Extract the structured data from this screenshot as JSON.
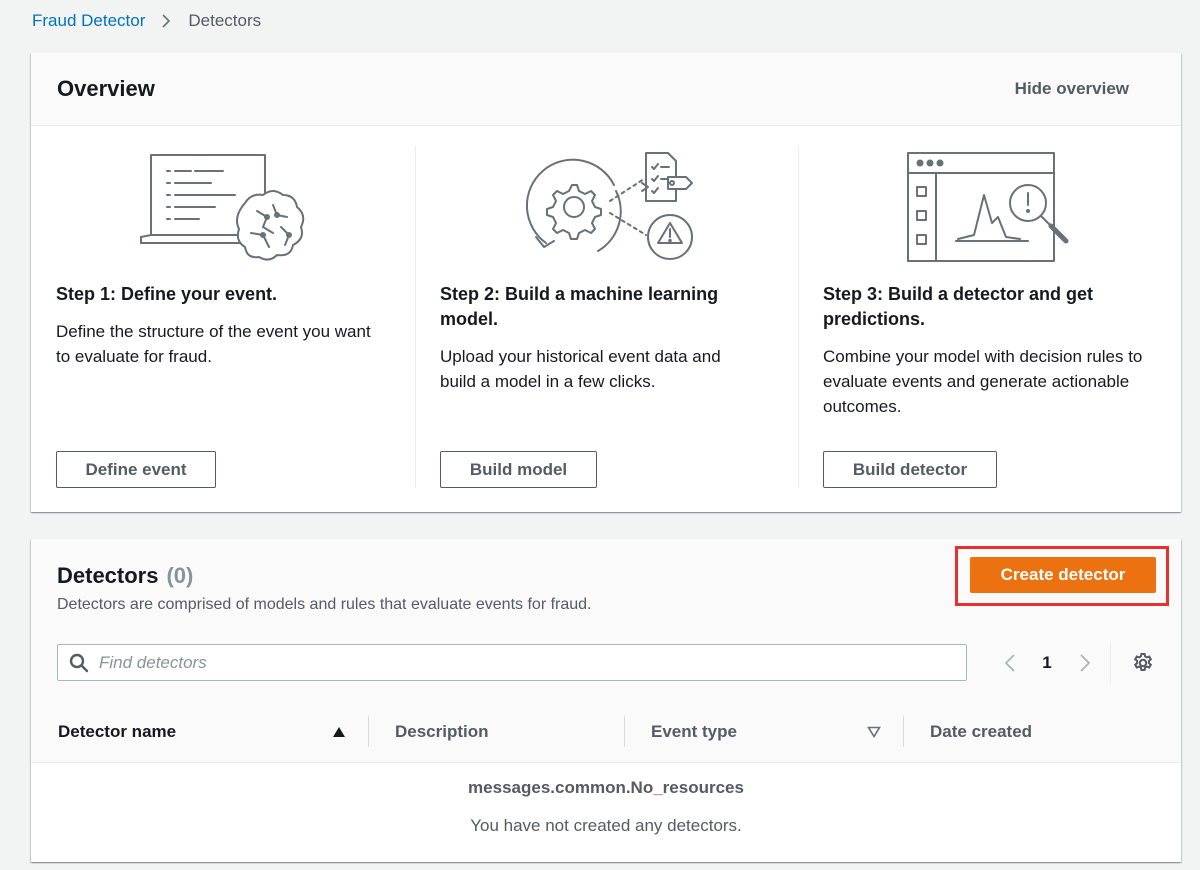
{
  "breadcrumb": {
    "items": [
      {
        "label": "Fraud Detector",
        "link": true
      },
      {
        "label": "Detectors",
        "link": false
      }
    ],
    "separator_icon": "chevron-right-icon"
  },
  "overview": {
    "title": "Overview",
    "hide_label": "Hide overview",
    "steps": [
      {
        "icon": "laptop-brain-icon",
        "title": "Step 1: Define your event.",
        "description": "Define the structure of the event you want to evaluate for fraud.",
        "button": "Define event"
      },
      {
        "icon": "gear-checklist-warning-icon",
        "title": "Step 2: Build a machine learning model.",
        "description": "Upload your historical event data and build a model in a few clicks.",
        "button": "Build model"
      },
      {
        "icon": "browser-chart-magnifier-icon",
        "title": "Step 3: Build a detector and get predictions.",
        "description": "Combine your model with decision rules to evaluate events and generate actionable outcomes.",
        "button": "Build detector"
      }
    ]
  },
  "detectors": {
    "title": "Detectors",
    "count": "(0)",
    "description": "Detectors are comprised of models and rules that evaluate events for fraud.",
    "create_button": "Create detector",
    "search_placeholder": "Find detectors",
    "search_value": "",
    "pagination": {
      "current_page": "1"
    },
    "columns": [
      {
        "label": "Detector name",
        "sort": "ascending"
      },
      {
        "label": "Description",
        "sort": "none"
      },
      {
        "label": "Event type",
        "sort": "sortable"
      },
      {
        "label": "Date created",
        "sort": "none"
      }
    ],
    "empty_state": {
      "title": "messages.common.No_resources",
      "message": "You have not created any detectors."
    }
  },
  "colors": {
    "primary_button": "#ec7211",
    "link": "#0073bb",
    "highlight_box": "#e5312f",
    "text": "#16191f",
    "secondary_text": "#545b64"
  }
}
